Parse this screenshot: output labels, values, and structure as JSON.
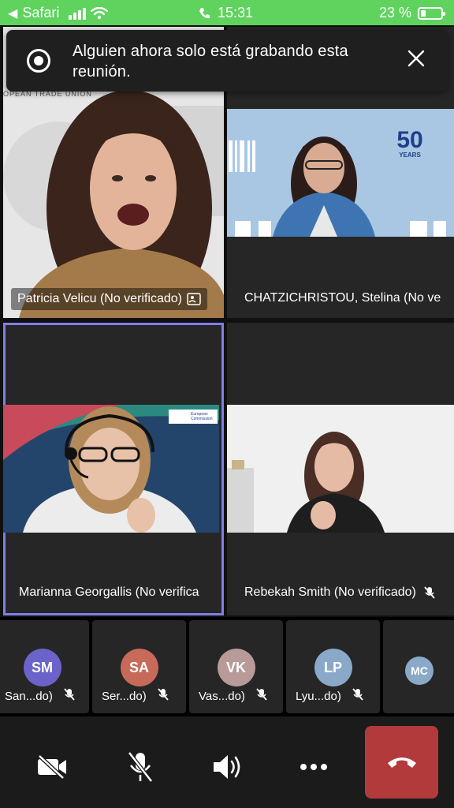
{
  "status_bar": {
    "back_app": "Safari",
    "time": "15:31",
    "battery": "23 %",
    "battery_level": 0.23,
    "bg_color": "#5fd35e"
  },
  "notification": {
    "message": "Alguien ahora solo está grabando esta reunión.",
    "icon": "recording-icon",
    "close_icon": "close-icon"
  },
  "video_tiles": [
    {
      "name": "Patricia Velicu (No verificado)",
      "active": true,
      "badge_icon": "contact-card-icon"
    },
    {
      "name": "CHATZICHRISTOU, Stelina (No ve",
      "active": false
    },
    {
      "name": "Marianna Georgallis (No verifica",
      "active": true
    },
    {
      "name": "Rebekah Smith (No verificado)",
      "active": false,
      "mic_icon": "mic-muted-icon"
    }
  ],
  "video_text": {
    "tile1_banner": "OPEAN TRADE UNION",
    "tile2_logo_big": "50",
    "tile2_logo_small": "YEARS",
    "tile3_logo": "European Commission"
  },
  "participants": [
    {
      "initials": "SM",
      "label": "San...do)",
      "color": "#6b63c9"
    },
    {
      "initials": "SA",
      "label": "Ser...do)",
      "color": "#c76a5a"
    },
    {
      "initials": "VK",
      "label": "Vas...do)",
      "color": "#b89a98"
    },
    {
      "initials": "LP",
      "label": "Lyu...do)",
      "color": "#8aa9c8"
    },
    {
      "initials": "MC",
      "label": "",
      "color": "#8aa9c8"
    }
  ],
  "controls": {
    "camera": "camera-off-icon",
    "mic": "mic-off-icon",
    "speaker": "speaker-icon",
    "more": "more-icon",
    "hangup": "hangup-icon",
    "hangup_color": "#b33a3a"
  }
}
